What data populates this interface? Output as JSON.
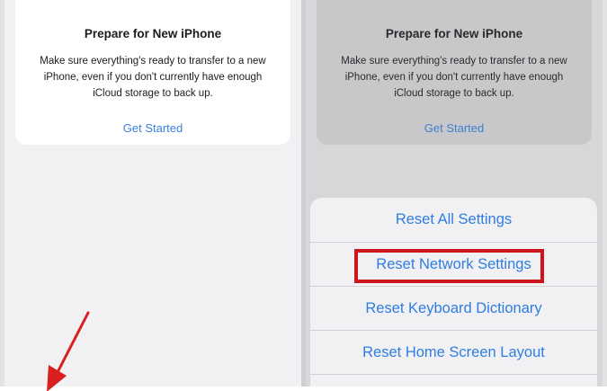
{
  "left_screen": {
    "card": {
      "title": "Prepare for New iPhone",
      "body": "Make sure everything's ready to transfer to a new iPhone, even if you don't currently have enough iCloud storage to back up.",
      "link": "Get Started"
    }
  },
  "right_screen": {
    "card": {
      "title": "Prepare for New iPhone",
      "body": "Make sure everything's ready to transfer to a new iPhone, even if you don't currently have enough iCloud storage to back up.",
      "link": "Get Started"
    },
    "action_sheet": {
      "items": [
        "Reset All Settings",
        "Reset Network Settings",
        "Reset Keyboard Dictionary",
        "Reset Home Screen Layout"
      ],
      "highlighted_index": 1
    }
  },
  "icons": {
    "card_icon": "iphone-icon",
    "annotation": "red-arrow-icon"
  },
  "colors": {
    "link_blue": "#3a80d9",
    "action_blue": "#2f7de0",
    "highlight_red": "#d0141b",
    "arrow_red": "#d9201f"
  }
}
